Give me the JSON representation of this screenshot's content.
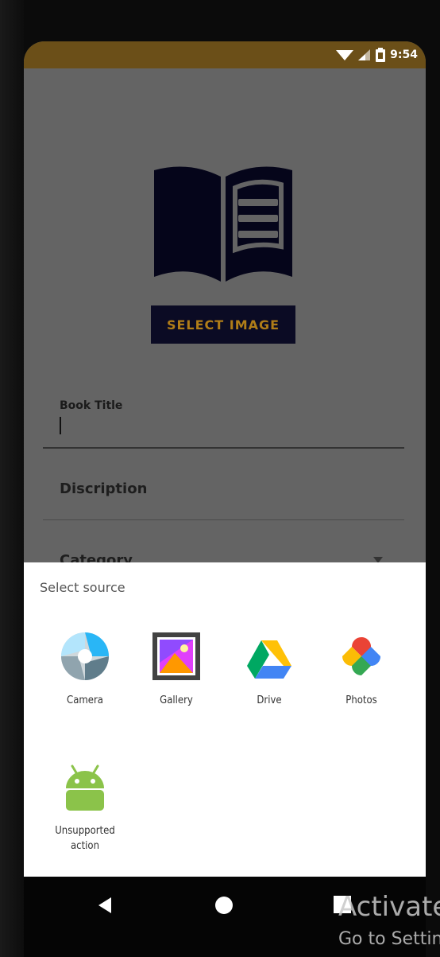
{
  "status_bar": {
    "time": "9:54"
  },
  "form": {
    "select_image_label": "SELECT IMAGE",
    "book_title_label": "Book Title",
    "description_label": "Discription",
    "category_label": "Category"
  },
  "sheet": {
    "title": "Select source",
    "apps": [
      {
        "label": "Camera",
        "icon": "camera-icon"
      },
      {
        "label": "Gallery",
        "icon": "gallery-icon"
      },
      {
        "label": "Drive",
        "icon": "drive-icon"
      },
      {
        "label": "Photos",
        "icon": "photos-icon"
      },
      {
        "label": "Unsupported action",
        "icon": "android-icon"
      }
    ]
  },
  "overlay": {
    "activate_line1": "Activate",
    "activate_line2": "Go to Settings"
  },
  "colors": {
    "status_bar": "#6b4f18",
    "button_bg": "#0b0b24",
    "button_text": "#b07d18"
  }
}
